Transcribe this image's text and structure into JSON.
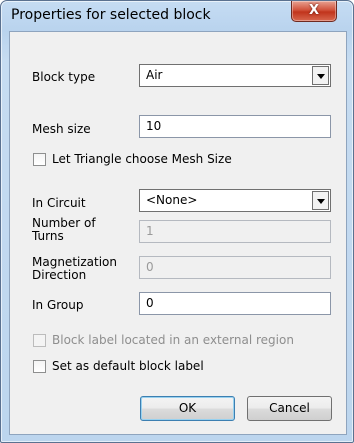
{
  "window": {
    "title": "Properties for selected block",
    "close_glyph": "X"
  },
  "block_type": {
    "label": "Block type",
    "value": "Air"
  },
  "mesh_size": {
    "label": "Mesh size",
    "value": "10"
  },
  "triangle_checkbox": {
    "label": "Let Triangle choose Mesh Size",
    "checked": false
  },
  "in_circuit": {
    "label": "In Circuit",
    "value": "<None>"
  },
  "number_of_turns": {
    "label_line1": "Number of",
    "label_line2": "Turns",
    "value": "1"
  },
  "magnetization_direction": {
    "label_line1": "Magnetization",
    "label_line2": "Direction",
    "value": "0"
  },
  "in_group": {
    "label": "In Group",
    "value": "0"
  },
  "external_region_checkbox": {
    "label": "Block label located in an external region",
    "checked": false
  },
  "default_label_checkbox": {
    "label": "Set as default block label",
    "checked": false
  },
  "buttons": {
    "ok": "OK",
    "cancel": "Cancel"
  }
}
